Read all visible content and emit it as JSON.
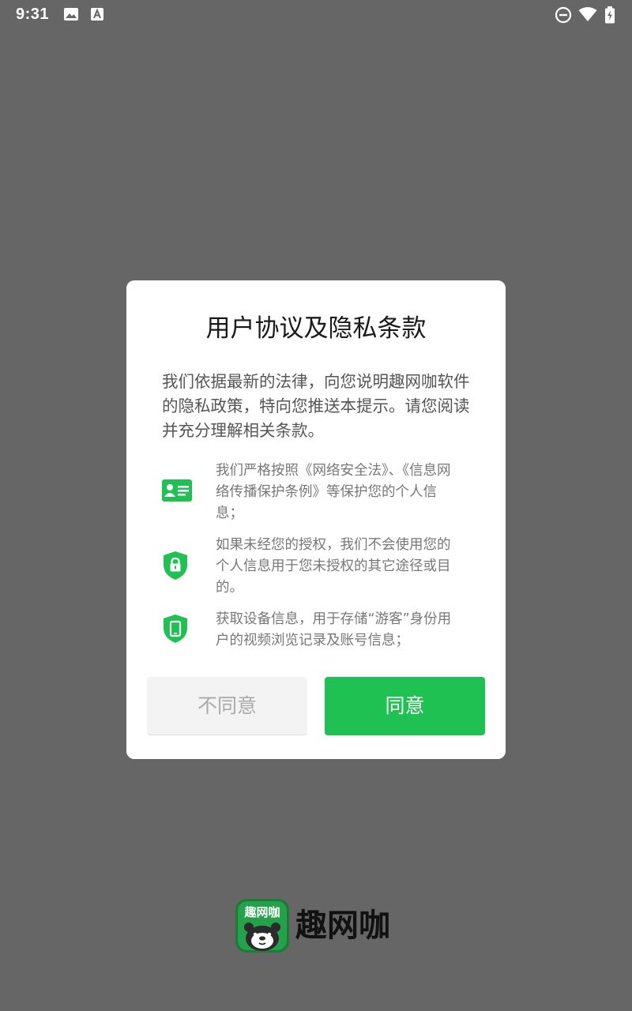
{
  "status_bar": {
    "time": "9:31",
    "left_icons": [
      "image-icon",
      "font-icon"
    ],
    "right_icons": [
      "dnd-icon",
      "wifi-icon",
      "battery-icon"
    ]
  },
  "dialog": {
    "title": "用户协议及隐私条款",
    "intro": "我们依据最新的法律，向您说明趣网咖软件的隐私政策，特向您推送本提示。请您阅读并充分理解相关条款。",
    "items": [
      {
        "icon": "id-card-icon",
        "text": "我们严格按照《网络安全法》、《信息网络传播保护条例》等保护您的个人信息；"
      },
      {
        "icon": "shield-lock-icon",
        "text": "如果未经您的授权，我们不会使用您的个人信息用于您未授权的其它途径或目的。"
      },
      {
        "icon": "shield-phone-icon",
        "text": "获取设备信息，用于存储“游客”身份用户的视频浏览记录及账号信息；"
      }
    ],
    "disagree_label": "不同意",
    "agree_label": "同意"
  },
  "brand": {
    "name": "趣网咖",
    "logo_text": "趣网咖"
  },
  "colors": {
    "accent": "#1ec152",
    "backdrop": "#666666",
    "logo_bg": "#1d7a38"
  }
}
